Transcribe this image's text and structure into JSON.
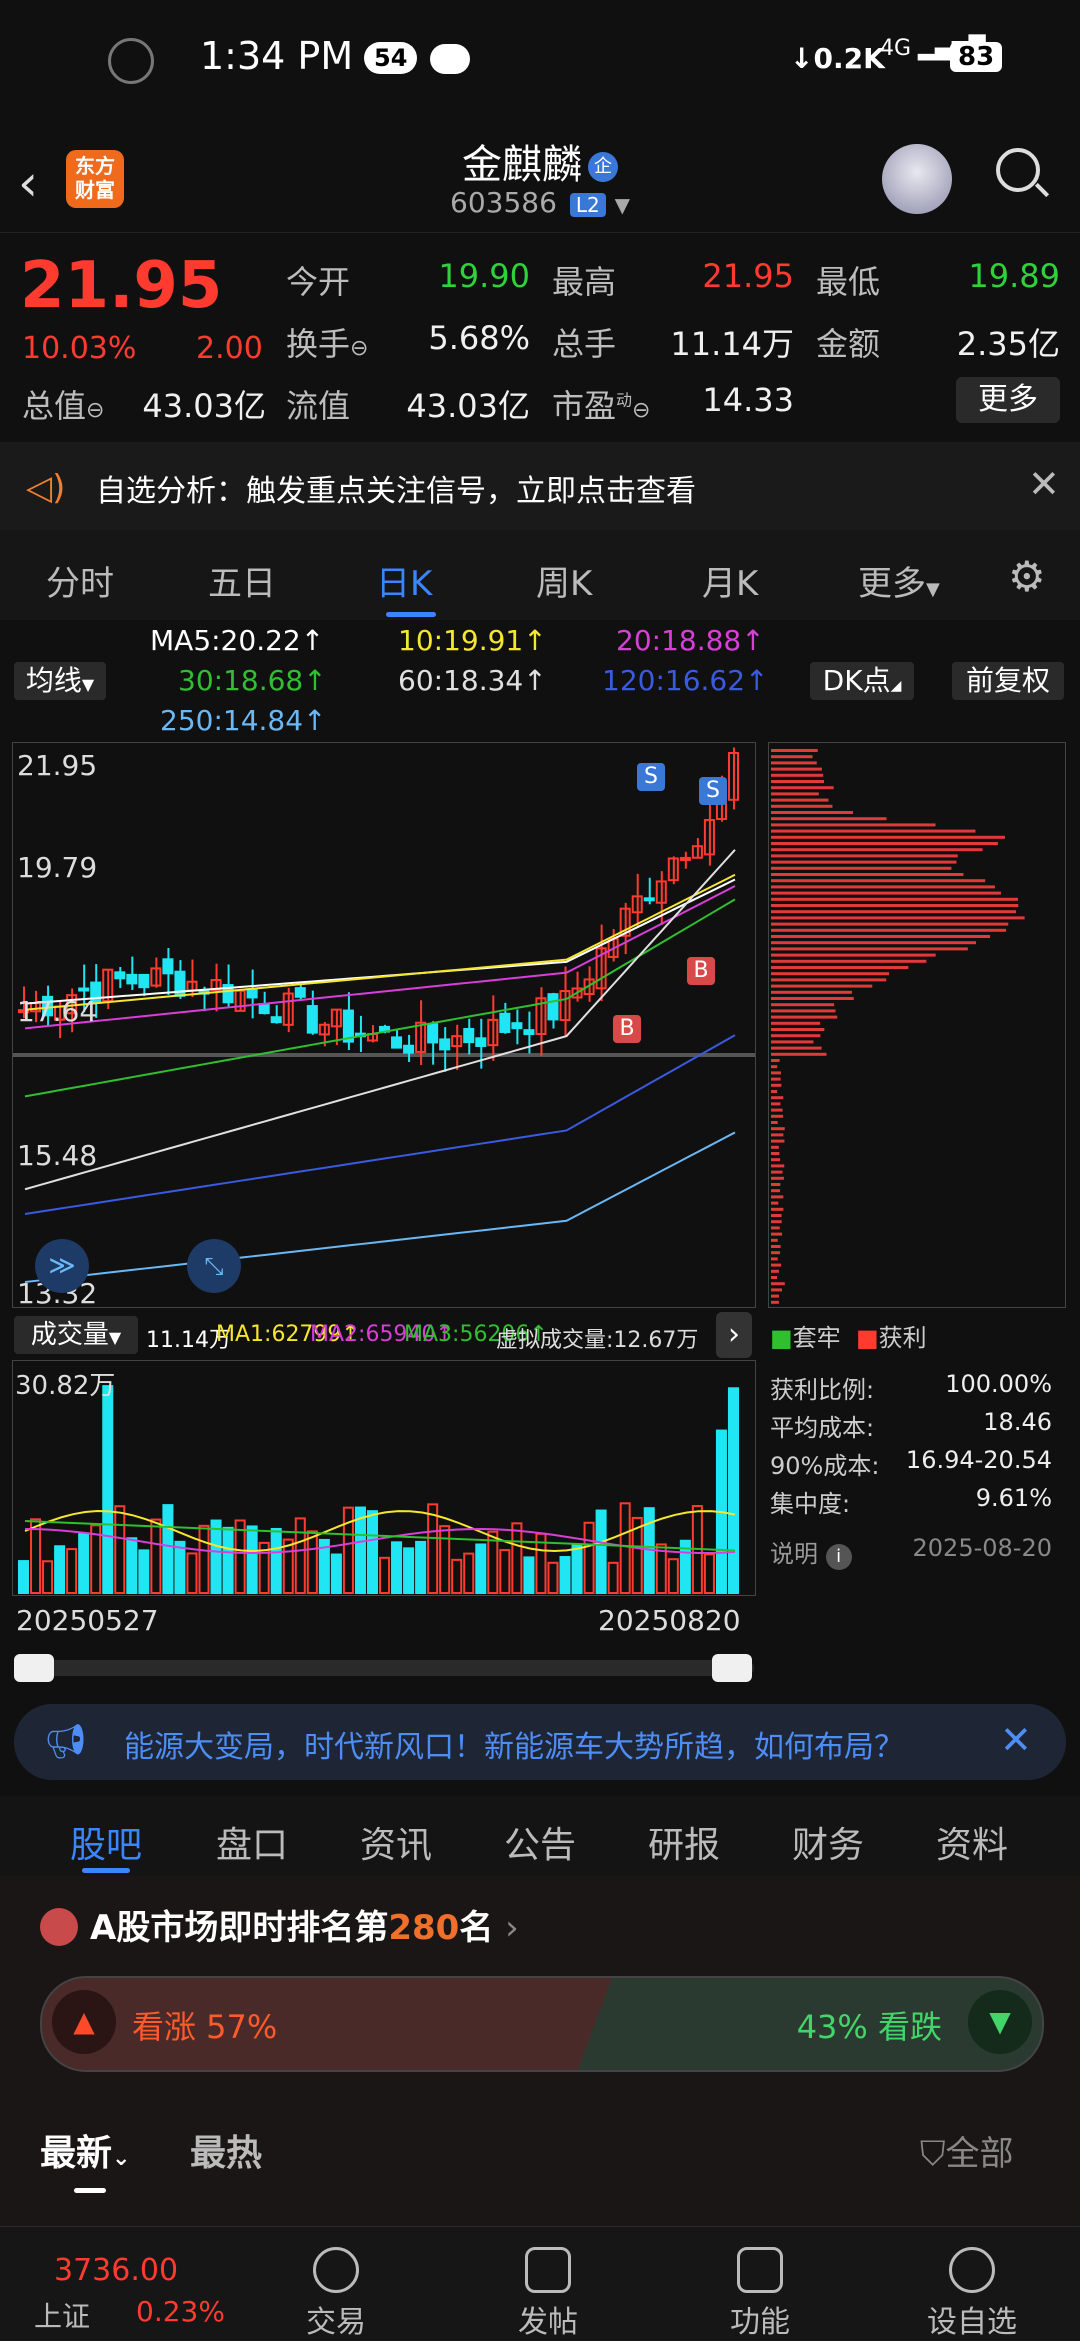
{
  "status": {
    "time": "1:34 PM",
    "badge": "54",
    "net": "0.2K",
    "signal": "4G",
    "battery": "83"
  },
  "header": {
    "logo_line1": "东方",
    "logo_line2": "财富",
    "title": "金麒麟",
    "badge": "企",
    "code": "603586",
    "level": "L2"
  },
  "quote": {
    "price": "21.95",
    "pct": "10.03%",
    "change": "2.00",
    "open_label": "今开",
    "open": "19.90",
    "high_label": "最高",
    "high": "21.95",
    "low_label": "最低",
    "low": "19.89",
    "turnover_label": "换手",
    "turnover": "5.68%",
    "volume_label": "总手",
    "volume": "11.14万",
    "amount_label": "金额",
    "amount": "2.35亿",
    "mktcap_label": "总值",
    "mktcap": "43.03亿",
    "float_label": "流值",
    "float": "43.03亿",
    "pe_label": "市盈",
    "pe_sup": "动",
    "pe": "14.33",
    "more": "更多"
  },
  "notice": {
    "text": "自选分析：触发重点关注信号，立即点击查看"
  },
  "ktabs": [
    "分时",
    "五日",
    "日K",
    "周K",
    "月K",
    "更多"
  ],
  "ma": {
    "btn": "均线",
    "ma5": "MA5:20.22↑",
    "ma10": "10:19.91↑",
    "ma20": "20:18.88↑",
    "ma30": "30:18.68↑",
    "ma60": "60:18.34↑",
    "ma120": "120:16.62↑",
    "ma250": "250:14.84↑",
    "dk": "DK点",
    "fq": "前复权"
  },
  "colors": {
    "up": "#ff3b30",
    "down": "#1fe6f2",
    "ma5": "#ffffff",
    "ma10": "#f5e630",
    "ma20": "#d83fd8",
    "ma30": "#2fbf2f",
    "ma60": "#e0e0e0",
    "ma120": "#3a5ae0",
    "ma250": "#6ab8f5",
    "accent": "#3a86ff"
  },
  "kchart": {
    "y_labels": [
      "21.95",
      "19.79",
      "17.64",
      "15.48",
      "13.32"
    ],
    "marks": [
      "S",
      "S",
      "B",
      "B"
    ]
  },
  "volbar": {
    "btn": "成交量",
    "v": "11.14万",
    "ma1": "MA1:62799↑",
    "ma2": "MA2:65940↑",
    "ma3": "MA3:56206↑",
    "virtual": "虚拟成交量:12.67万",
    "max": "30.82万",
    "date_start": "20250527",
    "date_end": "20250820"
  },
  "chips": {
    "legend_a": "套牢",
    "legend_b": "获利",
    "rows": [
      {
        "k": "获利比例:",
        "v": "100.00%"
      },
      {
        "k": "平均成本:",
        "v": "18.46"
      },
      {
        "k": "90%成本:",
        "v": "16.94-20.54"
      },
      {
        "k": "集中度:",
        "v": "9.61%"
      }
    ],
    "note": "说明",
    "date": "2025-08-20"
  },
  "banner": {
    "text": "能源大变局，时代新风口！新能源车大势所趋，如何布局？"
  },
  "stabs": [
    "股吧",
    "盘口",
    "资讯",
    "公告",
    "研报",
    "财务",
    "资料"
  ],
  "rank": {
    "prefix": "A股市场即时排名第",
    "num": "280",
    "suffix": "名",
    "up": "看涨 57%",
    "down": "43% 看跌",
    "sort_new": "最新",
    "sort_hot": "最热",
    "filter": "全部"
  },
  "bnav": {
    "index": "3736.00",
    "index_name": "上证",
    "index_pct": "0.23%",
    "items": [
      "交易",
      "发帖",
      "功能",
      "设自选"
    ]
  }
}
